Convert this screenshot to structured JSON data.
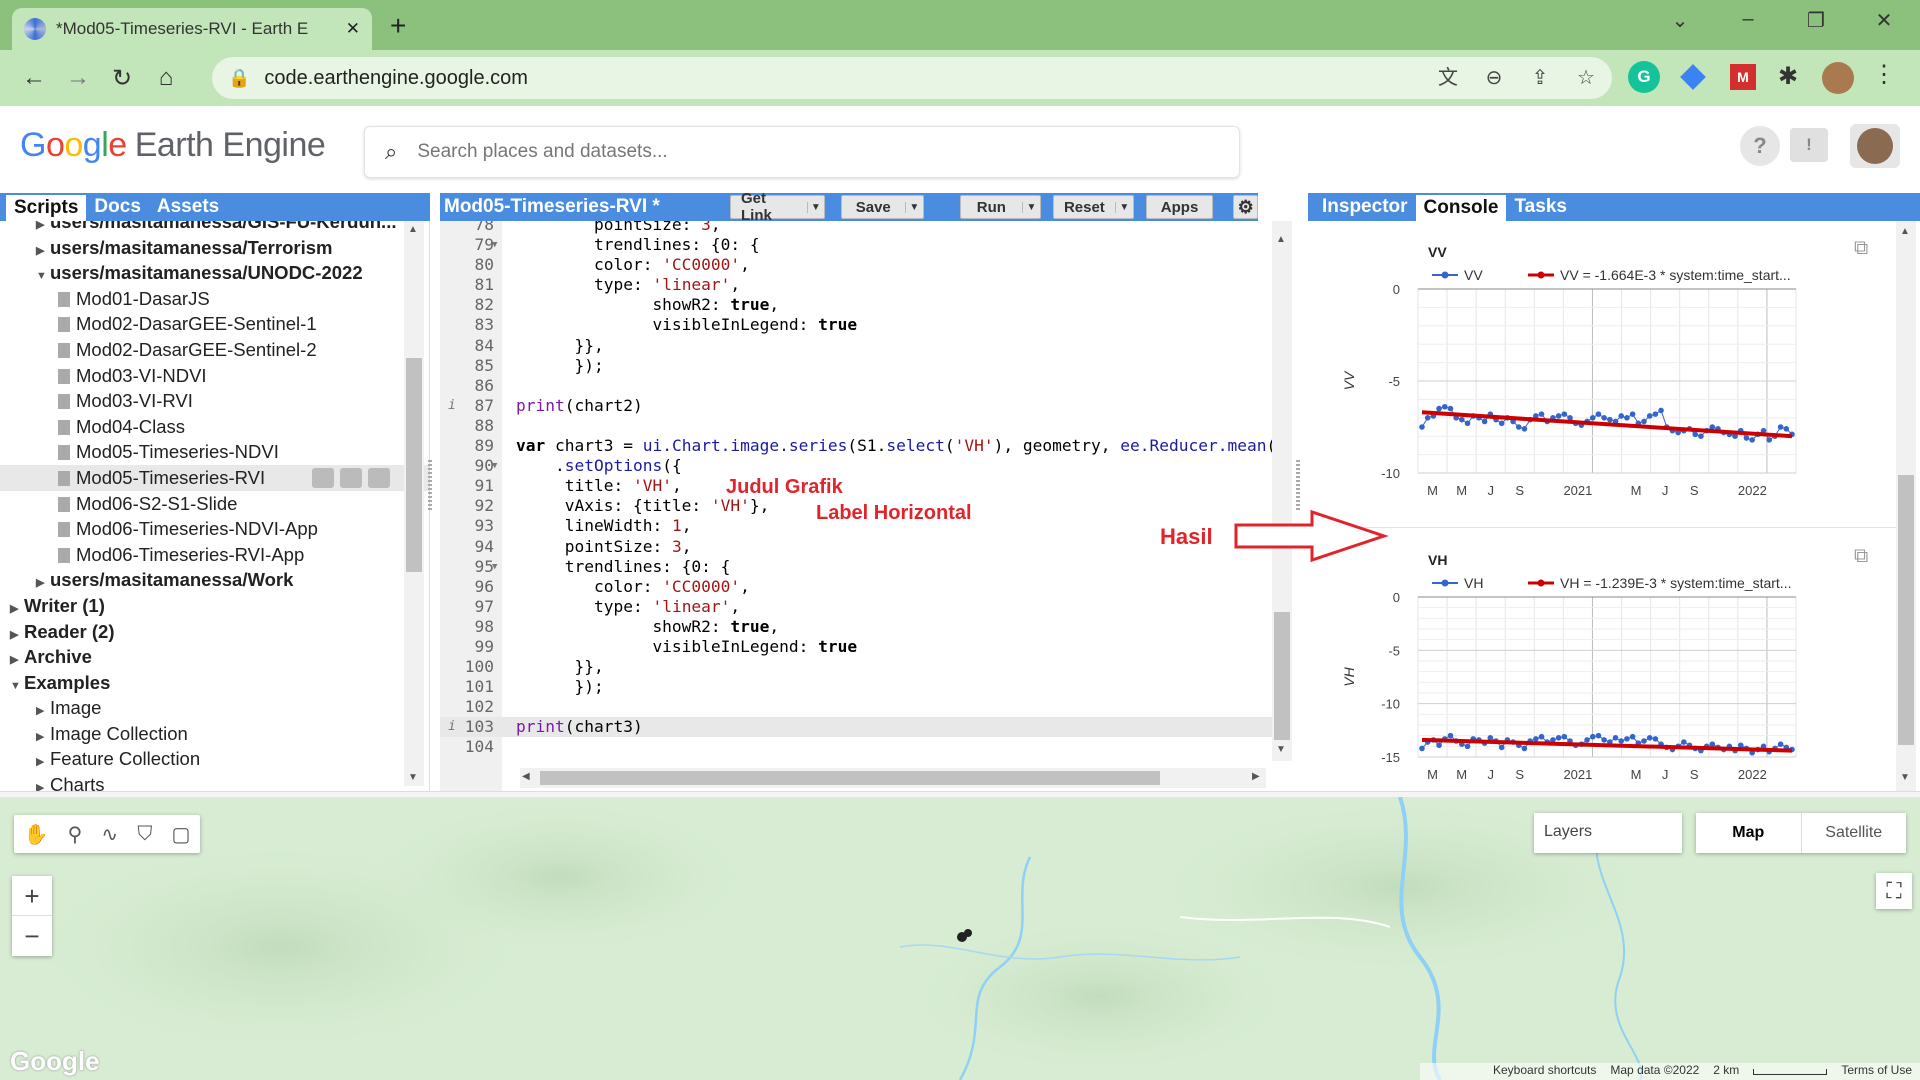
{
  "browser": {
    "tab_title": "*Mod05-Timeseries-RVI - Earth E",
    "tab_close": "✕",
    "new_tab": "+",
    "url": "code.earthengine.google.com",
    "window_controls": [
      "⌄",
      "–",
      "❐",
      "✕"
    ]
  },
  "app": {
    "logo_google": [
      "G",
      "o",
      "o",
      "g",
      "l",
      "e"
    ],
    "logo_product": "Earth Engine",
    "search_placeholder": "Search places and datasets...",
    "help_icon": "?",
    "feedback_icon": "!"
  },
  "left_panel": {
    "tabs": [
      "Scripts",
      "Docs",
      "Assets"
    ],
    "tree": [
      {
        "label": "users/masitamanessa/GIS-FU-Kerdun...",
        "level": 1,
        "type": "folder",
        "bold": true,
        "expanded": false
      },
      {
        "label": "users/masitamanessa/Terrorism",
        "level": 1,
        "type": "folder",
        "bold": true,
        "expanded": false
      },
      {
        "label": "users/masitamanessa/UNODC-2022",
        "level": 1,
        "type": "folder",
        "bold": true,
        "expanded": true
      },
      {
        "label": "Mod01-DasarJS",
        "level": 2,
        "type": "file"
      },
      {
        "label": "Mod02-DasarGEE-Sentinel-1",
        "level": 2,
        "type": "file"
      },
      {
        "label": "Mod02-DasarGEE-Sentinel-2",
        "level": 2,
        "type": "file"
      },
      {
        "label": "Mod03-VI-NDVI",
        "level": 2,
        "type": "file"
      },
      {
        "label": "Mod03-VI-RVI",
        "level": 2,
        "type": "file"
      },
      {
        "label": "Mod04-Class",
        "level": 2,
        "type": "file"
      },
      {
        "label": "Mod05-Timeseries-NDVI",
        "level": 2,
        "type": "file"
      },
      {
        "label": "Mod05-Timeseries-RVI",
        "level": 2,
        "type": "file",
        "selected": true
      },
      {
        "label": "Mod06-S2-S1-Slide",
        "level": 2,
        "type": "file"
      },
      {
        "label": "Mod06-Timeseries-NDVI-App",
        "level": 2,
        "type": "file"
      },
      {
        "label": "Mod06-Timeseries-RVI-App",
        "level": 2,
        "type": "file"
      },
      {
        "label": "users/masitamanessa/Work",
        "level": 1,
        "type": "folder",
        "bold": true,
        "expanded": false
      },
      {
        "label": "Writer (1)",
        "level": 0,
        "type": "folder",
        "bold": true,
        "expanded": false
      },
      {
        "label": "Reader (2)",
        "level": 0,
        "type": "folder",
        "bold": true,
        "expanded": false
      },
      {
        "label": "Archive",
        "level": 0,
        "type": "folder",
        "bold": true,
        "expanded": false
      },
      {
        "label": "Examples",
        "level": 0,
        "type": "folder",
        "bold": true,
        "expanded": true
      },
      {
        "label": "Image",
        "level": 1,
        "type": "folder",
        "expanded": false
      },
      {
        "label": "Image Collection",
        "level": 1,
        "type": "folder",
        "expanded": false
      },
      {
        "label": "Feature Collection",
        "level": 1,
        "type": "folder",
        "expanded": false
      },
      {
        "label": "Charts",
        "level": 1,
        "type": "folder",
        "expanded": false
      }
    ]
  },
  "editor": {
    "title": "Mod05-Timeseries-RVI *",
    "buttons": [
      "Get Link",
      "Save",
      "Run",
      "Reset",
      "Apps"
    ],
    "settings_icon": "⚙",
    "lines": [
      {
        "n": "78",
        "html": "        pointSize: <span class='str'>3</span>,"
      },
      {
        "n": "79",
        "fold": true,
        "html": "        trendlines: {0: {"
      },
      {
        "n": "80",
        "html": "        color: <span class='str'>'CC0000'</span>,"
      },
      {
        "n": "81",
        "html": "        type: <span class='str'>'linear'</span>,"
      },
      {
        "n": "82",
        "html": "              showR2: <span class='b'>true</span>,"
      },
      {
        "n": "83",
        "html": "              visibleInLegend: <span class='b'>true</span>"
      },
      {
        "n": "84",
        "html": "      }},"
      },
      {
        "n": "85",
        "html": "      });"
      },
      {
        "n": "86",
        "html": ""
      },
      {
        "n": "87",
        "info": true,
        "html": "<span class='fn'>print</span>(chart2)"
      },
      {
        "n": "88",
        "html": ""
      },
      {
        "n": "89",
        "html": "<span class='b'>var</span> chart3 = <span class='kw'>ui.Chart.image.series</span>(S1.<span class='kw'>select</span>(<span class='str'>'VH'</span>), geometry, <span class='kw'>ee.Reducer.mean</span>("
      },
      {
        "n": "90",
        "fold": true,
        "html": "    .<span class='kw'>setOptions</span>({"
      },
      {
        "n": "91",
        "html": "     title: <span class='str'>'VH'</span>,"
      },
      {
        "n": "92",
        "html": "     vAxis: {title: <span class='str'>'VH'</span>},"
      },
      {
        "n": "93",
        "html": "     lineWidth: <span class='str'>1</span>,"
      },
      {
        "n": "94",
        "html": "     pointSize: <span class='str'>3</span>,"
      },
      {
        "n": "95",
        "fold": true,
        "html": "     trendlines: {0: {"
      },
      {
        "n": "96",
        "html": "        color: <span class='str'>'CC0000'</span>,"
      },
      {
        "n": "97",
        "html": "        type: <span class='str'>'linear'</span>,"
      },
      {
        "n": "98",
        "html": "              showR2: <span class='b'>true</span>,"
      },
      {
        "n": "99",
        "html": "              visibleInLegend: <span class='b'>true</span>"
      },
      {
        "n": "100",
        "html": "      }},"
      },
      {
        "n": "101",
        "html": "      });"
      },
      {
        "n": "102",
        "html": ""
      },
      {
        "n": "103",
        "info": true,
        "cur": true,
        "html": "<span class='fn'>print</span>(chart3)"
      },
      {
        "n": "104",
        "html": ""
      }
    ],
    "annotations": {
      "judul": "Judul Grafik",
      "label": "Label Horizontal"
    }
  },
  "right_panel": {
    "tabs": [
      "Inspector",
      "Console",
      "Tasks"
    ],
    "active_tab": "Console",
    "hasil_label": "Hasil",
    "popout_icon": "⧉"
  },
  "chart_data": [
    {
      "type": "line",
      "title": "VV",
      "ylabel": "VV",
      "ylim": [
        -10,
        0
      ],
      "yticks": [
        "0",
        "-5",
        "-10"
      ],
      "xticks": [
        "M",
        "M",
        "J",
        "S",
        "2021",
        "M",
        "J",
        "S",
        "2022"
      ],
      "series": [
        {
          "name": "VV",
          "color": "#3366cc",
          "values": [
            -7.5,
            -7.0,
            -6.9,
            -6.5,
            -6.4,
            -6.5,
            -7.0,
            -7.1,
            -7.3,
            -6.9,
            -7.0,
            -7.2,
            -6.8,
            -7.1,
            -7.3,
            -7.0,
            -7.2,
            -7.5,
            -7.6,
            -7.1,
            -6.9,
            -6.8,
            -7.2,
            -7.0,
            -6.9,
            -6.8,
            -7.0,
            -7.3,
            -7.4,
            -7.2,
            -7.0,
            -6.8,
            -7.0,
            -7.1,
            -7.2,
            -6.9,
            -7.0,
            -6.8,
            -7.3,
            -7.2,
            -6.9,
            -6.8,
            -6.6,
            -7.5,
            -7.7,
            -7.8,
            -7.7,
            -7.6,
            -7.9,
            -8.0,
            -7.7,
            -7.5,
            -7.6,
            -7.8,
            -7.9,
            -8.0,
            -7.7,
            -8.1,
            -8.2,
            -7.9,
            -7.7,
            -8.2,
            -8.0,
            -7.5,
            -7.6,
            -7.9
          ]
        },
        {
          "name": "VV = -1.664E-3 * system:time_start...",
          "color": "#cc0000",
          "values": [
            -6.7,
            -8.0
          ]
        }
      ]
    },
    {
      "type": "line",
      "title": "VH",
      "ylabel": "VH",
      "ylim": [
        -15,
        0
      ],
      "yticks": [
        "0",
        "-5",
        "-10",
        "-15"
      ],
      "xticks": [
        "M",
        "M",
        "J",
        "S",
        "2021",
        "M",
        "J",
        "S",
        "2022"
      ],
      "series": [
        {
          "name": "VH",
          "color": "#3366cc",
          "values": [
            -14.2,
            -13.6,
            -13.4,
            -13.9,
            -13.3,
            -13.0,
            -13.5,
            -13.8,
            -14.0,
            -13.3,
            -13.4,
            -13.7,
            -13.2,
            -13.5,
            -14.1,
            -13.4,
            -13.6,
            -13.9,
            -14.2,
            -13.5,
            -13.3,
            -13.1,
            -13.6,
            -13.4,
            -13.2,
            -13.1,
            -13.5,
            -13.9,
            -13.8,
            -13.4,
            -13.1,
            -13.0,
            -13.4,
            -13.6,
            -13.2,
            -13.5,
            -13.3,
            -13.1,
            -13.7,
            -13.5,
            -13.2,
            -13.3,
            -13.8,
            -14.1,
            -14.3,
            -14.0,
            -13.6,
            -13.9,
            -14.2,
            -14.4,
            -14.0,
            -13.8,
            -14.1,
            -14.3,
            -14.0,
            -14.4,
            -13.9,
            -14.2,
            -14.6,
            -14.3,
            -14.0,
            -14.5,
            -14.2,
            -13.8,
            -14.1,
            -14.3
          ]
        },
        {
          "name": "VH = -1.239E-3 * system:time_start...",
          "color": "#cc0000",
          "values": [
            -13.4,
            -14.4
          ]
        }
      ]
    }
  ],
  "map": {
    "tools": [
      "✋",
      "⚲",
      "∿",
      "⛉",
      "▢"
    ],
    "zoom_in": "+",
    "zoom_out": "−",
    "layers_label": "Layers",
    "map_types": [
      "Map",
      "Satellite"
    ],
    "attribution": [
      "Keyboard shortcuts",
      "Map data ©2022",
      "2 km",
      "Terms of Use"
    ],
    "google_watermark": "Google"
  }
}
